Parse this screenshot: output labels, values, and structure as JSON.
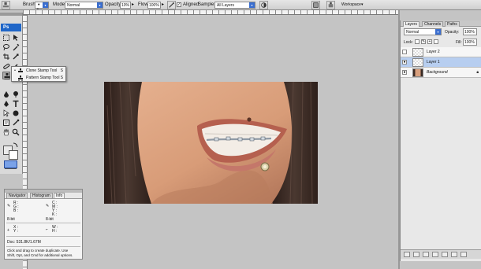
{
  "options_bar": {
    "brush_label": "Brush:",
    "brush_size": "9",
    "mode_label": "Mode:",
    "mode_value": "Normal",
    "opacity_label": "Opacity:",
    "opacity_value": "10%",
    "flow_label": "Flow:",
    "flow_value": "100%",
    "aligned_label": "Aligned",
    "sample_label": "Sample:",
    "sample_value": "All Layers",
    "workspace_label": "Workspace"
  },
  "tools": {
    "logo": "Ps"
  },
  "tool_flyout": {
    "items": [
      {
        "label": "Clone Stamp Tool",
        "shortcut": "S",
        "active": "•"
      },
      {
        "label": "Pattern Stamp Tool",
        "shortcut": "S",
        "active": ""
      }
    ]
  },
  "info_panel": {
    "tabs": [
      "Navigator",
      "Histogram",
      "Info"
    ],
    "rgb_labels": [
      "R :",
      "G :",
      "B :"
    ],
    "cmyk_labels": [
      "C :",
      "M :",
      "Y :",
      "K :"
    ],
    "bit_left": "8-bit",
    "bit_right": "8-bit",
    "xy_labels": [
      "X :",
      "Y :"
    ],
    "wh_labels": [
      "W :",
      "H :"
    ],
    "doc_size": "Doc: 531.8K/1.67M",
    "hint": [
      "Click and drag to create duplicate. Use",
      "Shift, Opt, and Cmd for additional options."
    ]
  },
  "layers_panel": {
    "tabs": [
      "Layers",
      "Channels",
      "Paths"
    ],
    "blend_mode": "Normal",
    "opacity_label": "Opacity:",
    "opacity_value": "100%",
    "lock_label": "Lock:",
    "fill_label": "Fill:",
    "fill_value": "100%",
    "layers": [
      {
        "name": "Layer 2",
        "visible": false,
        "selected": false
      },
      {
        "name": "Layer 1",
        "visible": true,
        "selected": true
      },
      {
        "name": "Background",
        "visible": true,
        "selected": false
      }
    ]
  },
  "colors": {
    "accent": "#1f66c8",
    "selection": "#b7cef0",
    "skin": "#d9a07e",
    "hair": "#3a2a24"
  }
}
